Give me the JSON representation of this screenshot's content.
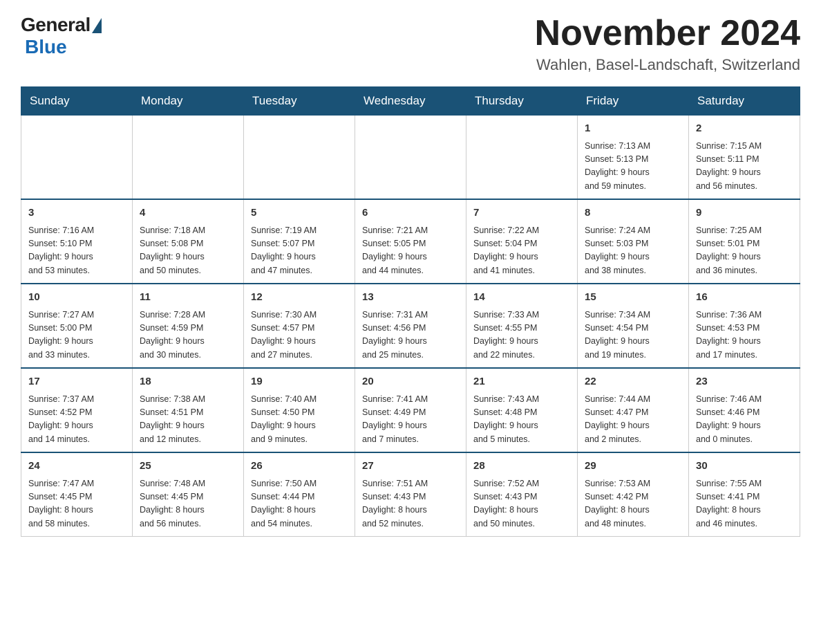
{
  "header": {
    "logo": {
      "general": "General",
      "blue": "Blue"
    },
    "title": "November 2024",
    "location": "Wahlen, Basel-Landschaft, Switzerland"
  },
  "weekdays": [
    "Sunday",
    "Monday",
    "Tuesday",
    "Wednesday",
    "Thursday",
    "Friday",
    "Saturday"
  ],
  "weeks": [
    [
      {
        "day": "",
        "info": ""
      },
      {
        "day": "",
        "info": ""
      },
      {
        "day": "",
        "info": ""
      },
      {
        "day": "",
        "info": ""
      },
      {
        "day": "",
        "info": ""
      },
      {
        "day": "1",
        "info": "Sunrise: 7:13 AM\nSunset: 5:13 PM\nDaylight: 9 hours\nand 59 minutes."
      },
      {
        "day": "2",
        "info": "Sunrise: 7:15 AM\nSunset: 5:11 PM\nDaylight: 9 hours\nand 56 minutes."
      }
    ],
    [
      {
        "day": "3",
        "info": "Sunrise: 7:16 AM\nSunset: 5:10 PM\nDaylight: 9 hours\nand 53 minutes."
      },
      {
        "day": "4",
        "info": "Sunrise: 7:18 AM\nSunset: 5:08 PM\nDaylight: 9 hours\nand 50 minutes."
      },
      {
        "day": "5",
        "info": "Sunrise: 7:19 AM\nSunset: 5:07 PM\nDaylight: 9 hours\nand 47 minutes."
      },
      {
        "day": "6",
        "info": "Sunrise: 7:21 AM\nSunset: 5:05 PM\nDaylight: 9 hours\nand 44 minutes."
      },
      {
        "day": "7",
        "info": "Sunrise: 7:22 AM\nSunset: 5:04 PM\nDaylight: 9 hours\nand 41 minutes."
      },
      {
        "day": "8",
        "info": "Sunrise: 7:24 AM\nSunset: 5:03 PM\nDaylight: 9 hours\nand 38 minutes."
      },
      {
        "day": "9",
        "info": "Sunrise: 7:25 AM\nSunset: 5:01 PM\nDaylight: 9 hours\nand 36 minutes."
      }
    ],
    [
      {
        "day": "10",
        "info": "Sunrise: 7:27 AM\nSunset: 5:00 PM\nDaylight: 9 hours\nand 33 minutes."
      },
      {
        "day": "11",
        "info": "Sunrise: 7:28 AM\nSunset: 4:59 PM\nDaylight: 9 hours\nand 30 minutes."
      },
      {
        "day": "12",
        "info": "Sunrise: 7:30 AM\nSunset: 4:57 PM\nDaylight: 9 hours\nand 27 minutes."
      },
      {
        "day": "13",
        "info": "Sunrise: 7:31 AM\nSunset: 4:56 PM\nDaylight: 9 hours\nand 25 minutes."
      },
      {
        "day": "14",
        "info": "Sunrise: 7:33 AM\nSunset: 4:55 PM\nDaylight: 9 hours\nand 22 minutes."
      },
      {
        "day": "15",
        "info": "Sunrise: 7:34 AM\nSunset: 4:54 PM\nDaylight: 9 hours\nand 19 minutes."
      },
      {
        "day": "16",
        "info": "Sunrise: 7:36 AM\nSunset: 4:53 PM\nDaylight: 9 hours\nand 17 minutes."
      }
    ],
    [
      {
        "day": "17",
        "info": "Sunrise: 7:37 AM\nSunset: 4:52 PM\nDaylight: 9 hours\nand 14 minutes."
      },
      {
        "day": "18",
        "info": "Sunrise: 7:38 AM\nSunset: 4:51 PM\nDaylight: 9 hours\nand 12 minutes."
      },
      {
        "day": "19",
        "info": "Sunrise: 7:40 AM\nSunset: 4:50 PM\nDaylight: 9 hours\nand 9 minutes."
      },
      {
        "day": "20",
        "info": "Sunrise: 7:41 AM\nSunset: 4:49 PM\nDaylight: 9 hours\nand 7 minutes."
      },
      {
        "day": "21",
        "info": "Sunrise: 7:43 AM\nSunset: 4:48 PM\nDaylight: 9 hours\nand 5 minutes."
      },
      {
        "day": "22",
        "info": "Sunrise: 7:44 AM\nSunset: 4:47 PM\nDaylight: 9 hours\nand 2 minutes."
      },
      {
        "day": "23",
        "info": "Sunrise: 7:46 AM\nSunset: 4:46 PM\nDaylight: 9 hours\nand 0 minutes."
      }
    ],
    [
      {
        "day": "24",
        "info": "Sunrise: 7:47 AM\nSunset: 4:45 PM\nDaylight: 8 hours\nand 58 minutes."
      },
      {
        "day": "25",
        "info": "Sunrise: 7:48 AM\nSunset: 4:45 PM\nDaylight: 8 hours\nand 56 minutes."
      },
      {
        "day": "26",
        "info": "Sunrise: 7:50 AM\nSunset: 4:44 PM\nDaylight: 8 hours\nand 54 minutes."
      },
      {
        "day": "27",
        "info": "Sunrise: 7:51 AM\nSunset: 4:43 PM\nDaylight: 8 hours\nand 52 minutes."
      },
      {
        "day": "28",
        "info": "Sunrise: 7:52 AM\nSunset: 4:43 PM\nDaylight: 8 hours\nand 50 minutes."
      },
      {
        "day": "29",
        "info": "Sunrise: 7:53 AM\nSunset: 4:42 PM\nDaylight: 8 hours\nand 48 minutes."
      },
      {
        "day": "30",
        "info": "Sunrise: 7:55 AM\nSunset: 4:41 PM\nDaylight: 8 hours\nand 46 minutes."
      }
    ]
  ]
}
